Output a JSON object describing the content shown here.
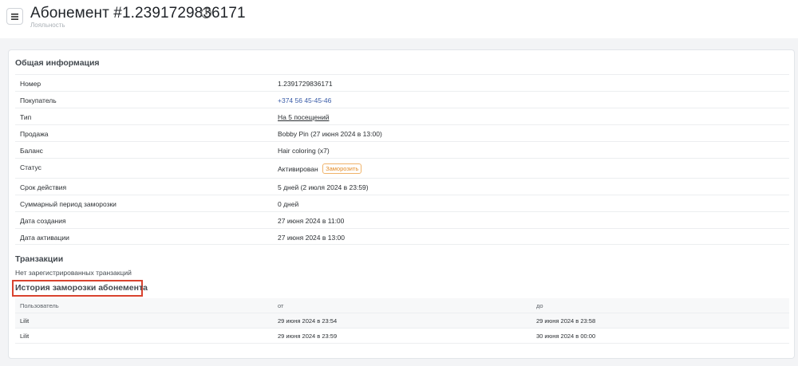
{
  "header": {
    "title": "Абонемент #1.2391729836171",
    "subtitle": "Лояльность",
    "info_icon_glyph": "i"
  },
  "general": {
    "title": "Общая информация",
    "rows": [
      {
        "label": "Номер",
        "value": "1.2391729836171"
      },
      {
        "label": "Покупатель",
        "value": "+374 56 45-45-46"
      },
      {
        "label": "Тип",
        "value": "На 5 посещений"
      },
      {
        "label": "Продажа",
        "value": "Bobby Pin (27 июня 2024 в 13:00)"
      },
      {
        "label": "Баланс",
        "value": "Hair coloring (x7)"
      },
      {
        "label": "Статус",
        "value": "Активирован",
        "action": "Заморозить"
      },
      {
        "label": "Срок действия",
        "value": "5 дней (2 июля 2024 в 23:59)"
      },
      {
        "label": "Суммарный период заморозки",
        "value": "0 дней"
      },
      {
        "label": "Дата создания",
        "value": "27 июня 2024 в 11:00"
      },
      {
        "label": "Дата активации",
        "value": "27 июня 2024 в 13:00"
      }
    ]
  },
  "transactions": {
    "title": "Транзакции",
    "empty_text": "Нет зарегистрированных транзакций"
  },
  "freeze_history": {
    "title": "История заморозки абонемента",
    "columns": [
      "Пользователь",
      "от",
      "до"
    ],
    "rows": [
      [
        "Lilit",
        "29 июня 2024 в 23:54",
        "29 июня 2024 в 23:58"
      ],
      [
        "Lilit",
        "29 июня 2024 в 23:59",
        "30 июня 2024 в 00:00"
      ]
    ]
  },
  "colors": {
    "accent_link": "#3a5ca8",
    "freeze_orange": "#e38b26",
    "highlight_red": "#d9432f"
  }
}
